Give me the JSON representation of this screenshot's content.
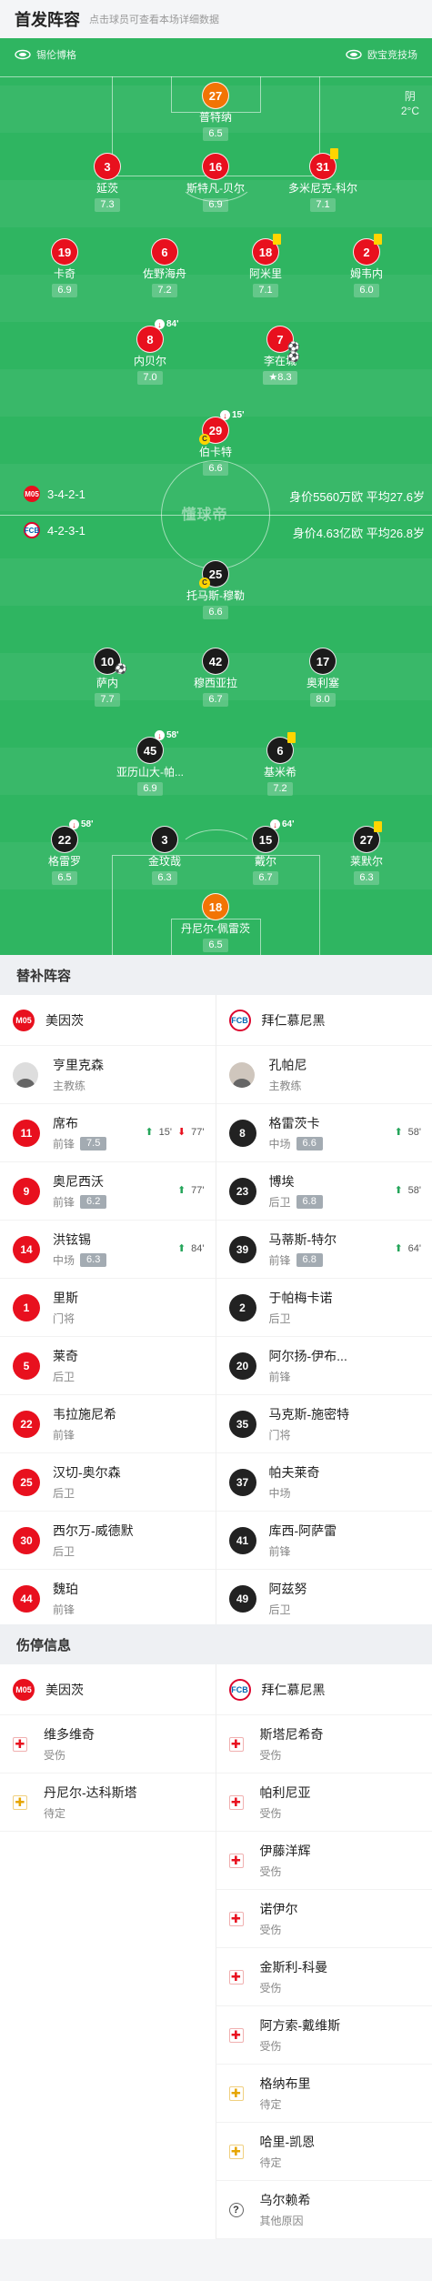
{
  "header": {
    "title": "首发阵容",
    "subtitle": "点击球员可查看本场详细数据"
  },
  "venue": {
    "home": "锡伦博格",
    "away": "欧宝竞技场"
  },
  "weather": {
    "condition": "阴",
    "temp": "2°C"
  },
  "formation": {
    "home": {
      "shape": "3-4-2-1",
      "value": "身价5560万欧 平均27.6岁"
    },
    "away": {
      "shape": "4-2-3-1",
      "value": "身价4.63亿欧 平均26.8岁"
    }
  },
  "watermark": "懂球帝",
  "players": [
    {
      "n": "27",
      "name": "普特纳",
      "r": "6.5",
      "c": "org"
    },
    {
      "n": "3",
      "name": "延茨",
      "r": "7.3",
      "c": "red"
    },
    {
      "n": "16",
      "name": "斯特凡-贝尔",
      "r": "6.9",
      "c": "red"
    },
    {
      "n": "31",
      "name": "多米尼克-科尔",
      "r": "7.1",
      "c": "red"
    },
    {
      "n": "19",
      "name": "卡奇",
      "r": "6.9",
      "c": "red"
    },
    {
      "n": "6",
      "name": "佐野海舟",
      "r": "7.2",
      "c": "red"
    },
    {
      "n": "18",
      "name": "阿米里",
      "r": "7.1",
      "c": "red"
    },
    {
      "n": "2",
      "name": "姆韦内",
      "r": "6.0",
      "c": "red"
    },
    {
      "n": "8",
      "name": "内贝尔",
      "r": "7.0",
      "c": "red",
      "sub": "84'"
    },
    {
      "n": "7",
      "name": "李在城",
      "r": "8.3",
      "c": "red"
    },
    {
      "n": "29",
      "name": "伯卡特",
      "r": "6.6",
      "c": "red",
      "sub": "15'"
    },
    {
      "n": "25",
      "name": "托马斯-穆勒",
      "r": "6.6",
      "c": "blk"
    },
    {
      "n": "10",
      "name": "萨内",
      "r": "7.7",
      "c": "blk"
    },
    {
      "n": "42",
      "name": "穆西亚拉",
      "r": "6.7",
      "c": "blk"
    },
    {
      "n": "17",
      "name": "奥利塞",
      "r": "8.0",
      "c": "blk"
    },
    {
      "n": "45",
      "name": "亚历山大-帕...",
      "r": "6.9",
      "c": "blk",
      "sub": "58'"
    },
    {
      "n": "6",
      "name": "基米希",
      "r": "7.2",
      "c": "blk"
    },
    {
      "n": "22",
      "name": "格雷罗",
      "r": "6.5",
      "c": "blk",
      "sub": "58'"
    },
    {
      "n": "3",
      "name": "金玟哉",
      "r": "6.3",
      "c": "blk"
    },
    {
      "n": "15",
      "name": "戴尔",
      "r": "6.7",
      "c": "blk",
      "sub": "64'"
    },
    {
      "n": "27",
      "name": "莱默尔",
      "r": "6.3",
      "c": "blk"
    },
    {
      "n": "18",
      "name": "丹尼尔-佩雷茨",
      "r": "6.5",
      "c": "org"
    }
  ],
  "subs_section": {
    "title": "替补阵容"
  },
  "teams": {
    "home": "美因茨",
    "away": "拜仁慕尼黑"
  },
  "badges": {
    "home": "M05",
    "away": "FCB"
  },
  "coaches": {
    "home": {
      "name": "亨里克森",
      "role": "主教练"
    },
    "away": {
      "name": "孔帕尼",
      "role": "主教练"
    }
  },
  "home_subs": [
    {
      "n": "11",
      "name": "席布",
      "pos": "前锋",
      "r": "7.5",
      "in": "15'",
      "out": "77'"
    },
    {
      "n": "9",
      "name": "奥尼西沃",
      "pos": "前锋",
      "r": "6.2",
      "in": "77'"
    },
    {
      "n": "14",
      "name": "洪铉锡",
      "pos": "中场",
      "r": "6.3",
      "in": "84'"
    },
    {
      "n": "1",
      "name": "里斯",
      "pos": "门将"
    },
    {
      "n": "5",
      "name": "莱奇",
      "pos": "后卫"
    },
    {
      "n": "22",
      "name": "韦拉施尼希",
      "pos": "前锋"
    },
    {
      "n": "25",
      "name": "汉切-奥尔森",
      "pos": "后卫"
    },
    {
      "n": "30",
      "name": "西尔万-威德默",
      "pos": "后卫"
    },
    {
      "n": "44",
      "name": "魏珀",
      "pos": "前锋"
    }
  ],
  "away_subs": [
    {
      "n": "8",
      "name": "格雷茨卡",
      "pos": "中场",
      "r": "6.6",
      "in": "58'"
    },
    {
      "n": "23",
      "name": "博埃",
      "pos": "后卫",
      "r": "6.8",
      "in": "58'"
    },
    {
      "n": "39",
      "name": "马蒂斯-特尔",
      "pos": "前锋",
      "r": "6.8",
      "in": "64'"
    },
    {
      "n": "2",
      "name": "于帕梅卡诺",
      "pos": "后卫"
    },
    {
      "n": "20",
      "name": "阿尔扬-伊布...",
      "pos": "前锋"
    },
    {
      "n": "35",
      "name": "马克斯-施密特",
      "pos": "门将"
    },
    {
      "n": "37",
      "name": "帕夫莱奇",
      "pos": "中场"
    },
    {
      "n": "41",
      "name": "库西-阿萨雷",
      "pos": "前锋"
    },
    {
      "n": "49",
      "name": "阿兹努",
      "pos": "后卫"
    }
  ],
  "injury_section": {
    "title": "伤停信息"
  },
  "home_injuries": [
    {
      "name": "维多维奇",
      "status": "受伤",
      "type": "inj"
    },
    {
      "name": "丹尼尔-达科斯塔",
      "status": "待定",
      "type": "susp"
    }
  ],
  "away_injuries": [
    {
      "name": "斯塔尼希奇",
      "status": "受伤",
      "type": "inj"
    },
    {
      "name": "帕利尼亚",
      "status": "受伤",
      "type": "inj"
    },
    {
      "name": "伊藤洋辉",
      "status": "受伤",
      "type": "inj"
    },
    {
      "name": "诺伊尔",
      "status": "受伤",
      "type": "inj"
    },
    {
      "name": "金斯利-科曼",
      "status": "受伤",
      "type": "inj"
    },
    {
      "name": "阿方索-戴维斯",
      "status": "受伤",
      "type": "inj"
    },
    {
      "name": "格纳布里",
      "status": "待定",
      "type": "susp"
    },
    {
      "name": "哈里-凯恩",
      "status": "待定",
      "type": "susp"
    },
    {
      "name": "乌尔赖希",
      "status": "其他原因",
      "type": "oth"
    }
  ]
}
